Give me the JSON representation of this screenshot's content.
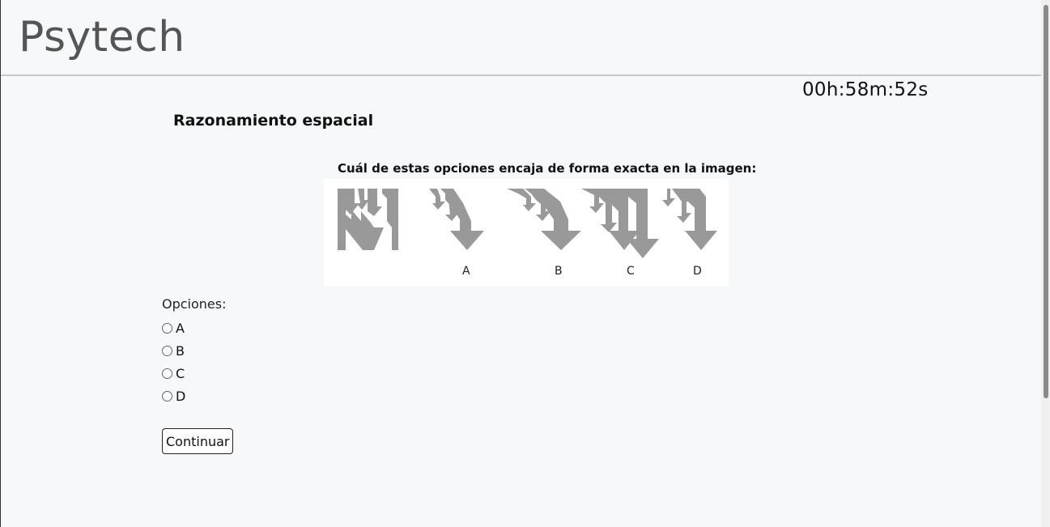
{
  "header": {
    "logo": "Psytech"
  },
  "timer": "00h:58m:52s",
  "section_title": "Razonamiento espacial",
  "question": {
    "text": "Cuál de estas opciones encaja de forma exacta en la imagen:",
    "figure_labels": [
      "A",
      "B",
      "C",
      "D"
    ],
    "figure_color": "#999999"
  },
  "options": {
    "label": "Opciones:",
    "items": [
      "A",
      "B",
      "C",
      "D"
    ]
  },
  "continue_label": "Continuar"
}
